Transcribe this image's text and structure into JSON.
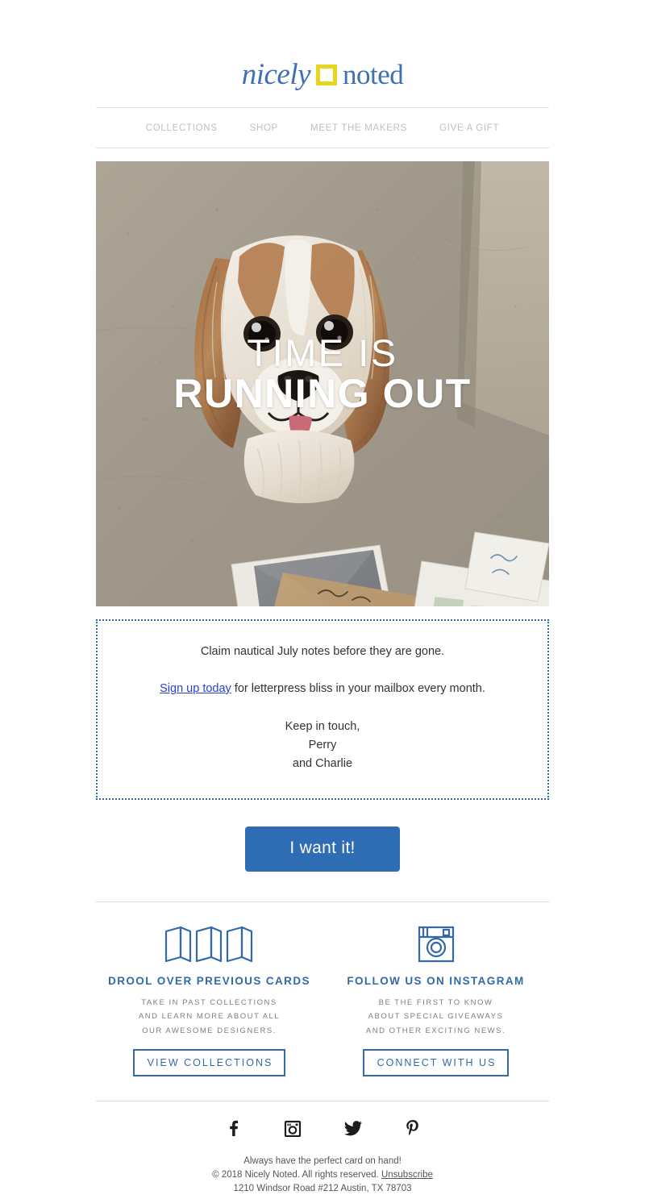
{
  "brand": {
    "logo_left": "nicely",
    "logo_right": "noted",
    "accent_blue": "#3f6fb5",
    "accent_yellow": "#e8d61e"
  },
  "nav": {
    "items": [
      {
        "label": "COLLECTIONS"
      },
      {
        "label": "SHOP"
      },
      {
        "label": "MEET THE MAKERS"
      },
      {
        "label": "GIVE A GIFT"
      }
    ]
  },
  "hero": {
    "headline_line1": "TIME IS",
    "headline_line2": "RUNNING OUT",
    "alt": "Cavalier King Charles Spaniel dog looking up beside letterpress cards and stamped envelopes on concrete"
  },
  "message": {
    "line1": "Claim nautical July notes before they are gone.",
    "link_text": "Sign up today",
    "line2_rest": " for letterpress bliss in your mailbox every month.",
    "signoff": "Keep in touch,",
    "name": "Perry",
    "name2": "and Charlie"
  },
  "cta": {
    "label": "I want it!",
    "color": "#2e6cb3"
  },
  "promos": [
    {
      "icon": "open-cards-icon",
      "title": "DROOL OVER PREVIOUS CARDS",
      "sub_line1": "TAKE IN PAST COLLECTIONS",
      "sub_line2": "AND LEARN MORE ABOUT ALL",
      "sub_line3": "OUR AWESOME DESIGNERS.",
      "button": "VIEW COLLECTIONS"
    },
    {
      "icon": "instagram-outline-icon",
      "title": "FOLLOW US ON INSTAGRAM",
      "sub_line1": "BE THE FIRST TO KNOW",
      "sub_line2": "ABOUT SPECIAL GIVEAWAYS",
      "sub_line3": "AND OTHER EXCITING NEWS.",
      "button": "CONNECT WITH US"
    }
  ],
  "social": [
    {
      "name": "facebook-icon"
    },
    {
      "name": "instagram-icon"
    },
    {
      "name": "twitter-icon"
    },
    {
      "name": "pinterest-icon"
    }
  ],
  "legal": {
    "tagline": "Always have the perfect card on hand!",
    "copyright": "© 2018 Nicely Noted. All rights reserved. ",
    "unsubscribe": "Unsubscribe",
    "address": "1210 Windsor Road #212 Austin, TX 78703"
  }
}
